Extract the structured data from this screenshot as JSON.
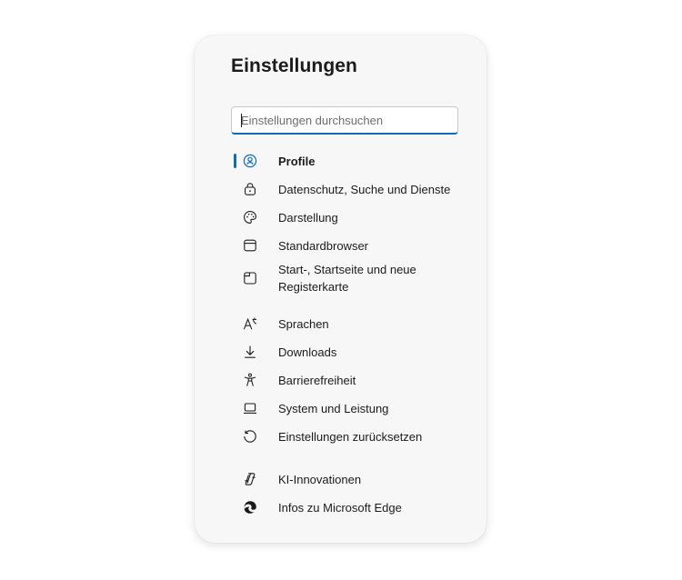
{
  "settings": {
    "title": "Einstellungen",
    "search": {
      "placeholder": "Einstellungen durchsuchen",
      "value": ""
    },
    "accent_color": "#0f6cbd",
    "active_item": "Profile",
    "items": [
      {
        "label": "Profile",
        "icon": "profile-icon"
      },
      {
        "label": "Datenschutz, Suche und Dienste",
        "icon": "lock-icon"
      },
      {
        "label": "Darstellung",
        "icon": "palette-icon"
      },
      {
        "label": "Standardbrowser",
        "icon": "browser-icon"
      },
      {
        "label": "Start-, Startseite und neue Registerkarte",
        "icon": "new-tab-icon"
      },
      {
        "label": "Sprachen",
        "icon": "language-icon"
      },
      {
        "label": "Downloads",
        "icon": "download-icon"
      },
      {
        "label": "Barrierefreiheit",
        "icon": "accessibility-icon"
      },
      {
        "label": "System und Leistung",
        "icon": "laptop-icon"
      },
      {
        "label": "Einstellungen zurücksetzen",
        "icon": "reset-icon"
      },
      {
        "label": "KI-Innovationen",
        "icon": "copilot-icon"
      },
      {
        "label": "Infos zu Microsoft Edge",
        "icon": "edge-logo-icon"
      }
    ]
  }
}
